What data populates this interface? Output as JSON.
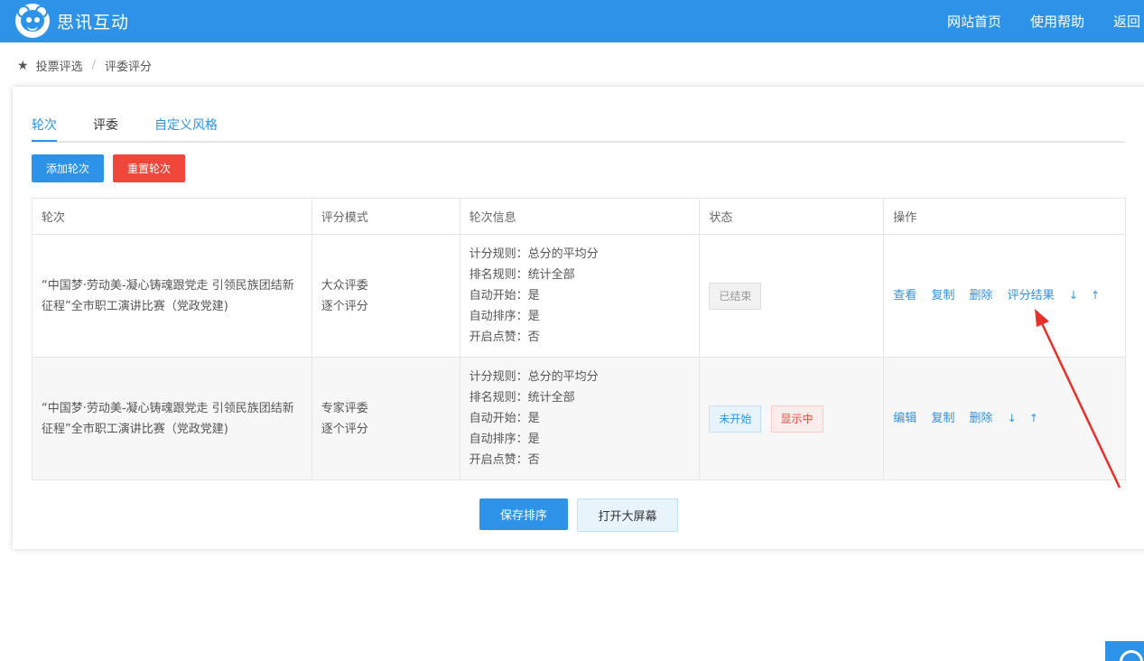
{
  "header": {
    "brand": "思讯互动",
    "nav": [
      "网站首页",
      "使用帮助",
      "返回"
    ]
  },
  "breadcrumb": {
    "item1": "投票评选",
    "item2": "评委评分"
  },
  "tabs": [
    "轮次",
    "评委",
    "自定义风格"
  ],
  "toolbar": {
    "add_label": "添加轮次",
    "reset_label": "重置轮次"
  },
  "table": {
    "headers": [
      "轮次",
      "评分模式",
      "轮次信息",
      "状态",
      "操作"
    ],
    "rows": [
      {
        "name": "“中国梦·劳动美-凝心铸魂跟党走 引领民族团结新征程”全市职工演讲比赛（党政党建)",
        "mode1": "大众评委",
        "mode2": "逐个评分",
        "info": [
          "计分规则：总分的平均分",
          "排名规则：统计全部",
          "自动开始：是",
          "自动排序：是",
          "开启点赞：否"
        ],
        "status": [
          "已结束"
        ],
        "ops": [
          "查看",
          "复制",
          "删除",
          "评分结果"
        ]
      },
      {
        "name": "“中国梦·劳动美-凝心铸魂跟党走 引领民族团结新征程”全市职工演讲比赛（党政党建)",
        "mode1": "专家评委",
        "mode2": "逐个评分",
        "info": [
          "计分规则：总分的平均分",
          "排名规则：统计全部",
          "自动开始：是",
          "自动排序：是",
          "开启点赞：否"
        ],
        "status": [
          "未开始",
          "显示中"
        ],
        "ops": [
          "编辑",
          "复制",
          "删除"
        ]
      }
    ]
  },
  "footer_buttons": {
    "save_label": "保存排序",
    "screen_label": "打开大屏幕"
  },
  "colors": {
    "primary": "#2d93e8",
    "danger": "#f0473c",
    "annotation": "#e8302a"
  },
  "icons": [
    "bear-logo-icon",
    "star-icon",
    "sort-down-icon",
    "sort-up-icon",
    "annotation-arrow-icon",
    "search-icon"
  ]
}
